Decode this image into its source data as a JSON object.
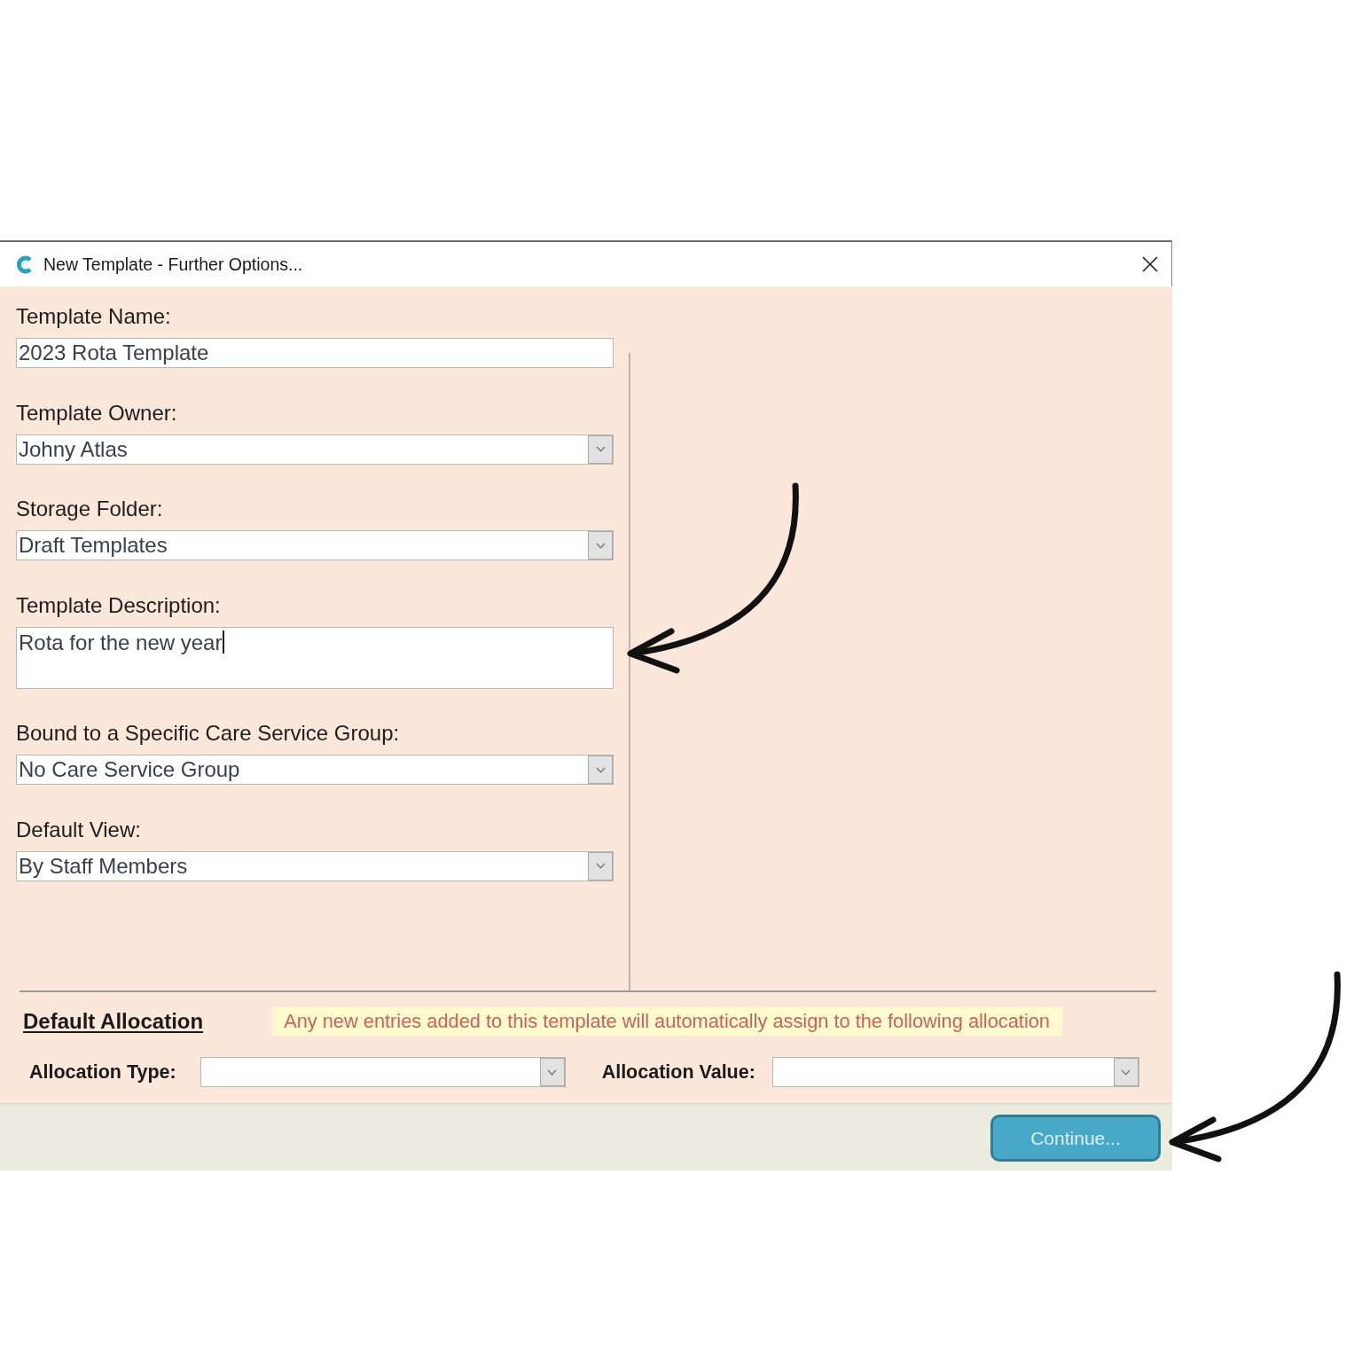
{
  "window": {
    "title": "New Template - Further Options..."
  },
  "fields": [
    {
      "kind": "text",
      "label": "Template Name:",
      "value": "2023 Rota Template",
      "focused": false,
      "callout_arrow": false
    },
    {
      "kind": "dropdown",
      "label": "Template Owner:",
      "value": "Johny Atlas",
      "focused": false,
      "callout_arrow": false
    },
    {
      "kind": "dropdown",
      "label": "Storage Folder:",
      "value": "Draft Templates",
      "focused": false,
      "callout_arrow": false
    },
    {
      "kind": "textarea",
      "label": "Template Description:",
      "value": "Rota for the new year",
      "focused": true,
      "callout_arrow": true
    },
    {
      "kind": "dropdown",
      "label": "Bound to a Specific Care Service Group:",
      "value": "No Care Service Group",
      "focused": false,
      "callout_arrow": false
    },
    {
      "kind": "dropdown",
      "label": "Default View:",
      "value": "By Staff Members",
      "focused": false,
      "callout_arrow": false
    }
  ],
  "default_allocation": {
    "heading": "Default Allocation",
    "note": "Any new entries added to this template will automatically assign to the following allocation",
    "fields": [
      {
        "kind": "dropdown",
        "label": "Allocation Type:"
      },
      {
        "kind": "dropdown",
        "label": "Allocation Value:"
      }
    ]
  },
  "buttons": [
    {
      "label": "Continue...",
      "callout_arrow": true
    }
  ]
}
